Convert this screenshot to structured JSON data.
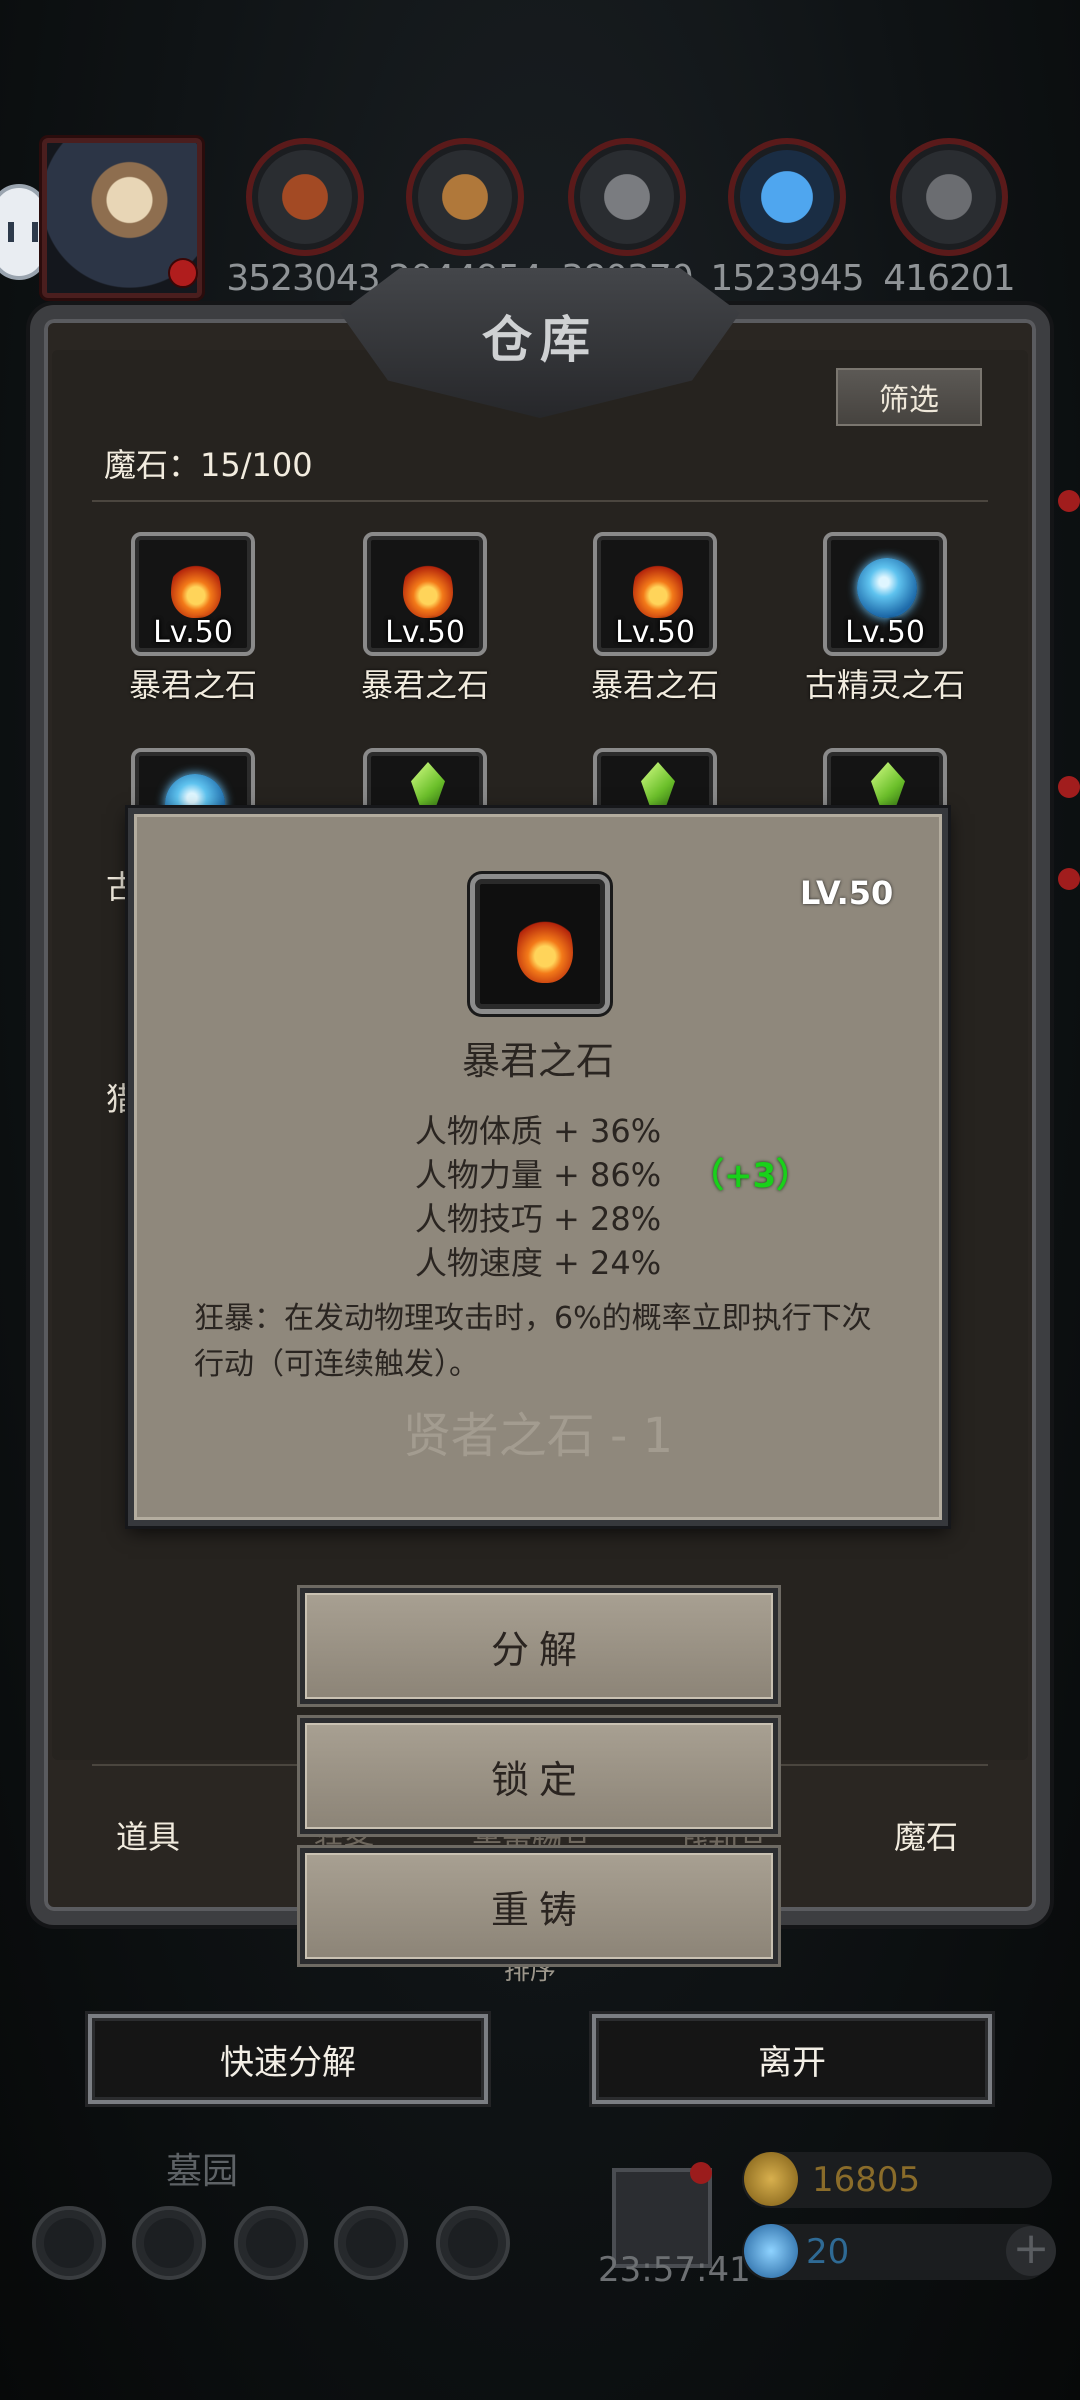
{
  "resources": [
    {
      "icon": "meat-icon",
      "value": "3523043",
      "color": "#8b3a1c"
    },
    {
      "icon": "wood-icon",
      "value": "2044954",
      "color": "#8a5a2a"
    },
    {
      "icon": "stone-icon",
      "value": "380370",
      "color": "#6d6f73"
    },
    {
      "icon": "crystal-icon",
      "value": "1523945",
      "color": "#2f7fd1"
    },
    {
      "icon": "iron-icon",
      "value": "416201",
      "color": "#55575b"
    }
  ],
  "warehouse": {
    "title": "仓库",
    "filter_label": "筛选",
    "stone_count": "魔石：15/100"
  },
  "items": [
    {
      "icon": "fire-stone-icon",
      "level": "Lv.50",
      "name": "暴君之石"
    },
    {
      "icon": "fire-stone-icon",
      "level": "Lv.50",
      "name": "暴君之石"
    },
    {
      "icon": "fire-stone-icon",
      "level": "Lv.50",
      "name": "暴君之石"
    },
    {
      "icon": "water-stone-icon",
      "level": "Lv.50",
      "name": "古精灵之石"
    }
  ],
  "partial_names": {
    "left1": "古",
    "left2": "猎"
  },
  "popup": {
    "level": "LV.50",
    "name": "暴君之石",
    "stats": [
      "人物体质 + 36%",
      "人物力量 + 86%",
      "人物技巧 + 28%",
      "人物速度 + 24%"
    ],
    "bonus": "（+3）",
    "description": "狂暴：在发动物理攻击时，6%的概率立即执行下次行动（可连续触发）。",
    "faded_text": "贤者之石 - 1"
  },
  "actions": {
    "decompose": "分解",
    "lock": "锁定",
    "reforge": "重铸"
  },
  "tabs": {
    "items": "道具",
    "magic_stones": "魔石",
    "hidden1": "装备",
    "hidden2": "贵重物品",
    "hidden3": "战利品",
    "hidden4": "排序"
  },
  "buttons": {
    "quick_decompose": "快速分解",
    "leave": "离开"
  },
  "hud": {
    "location": "墓园",
    "timer": "23:57:41",
    "gold": "16805",
    "gems": "20",
    "plus": "+"
  }
}
